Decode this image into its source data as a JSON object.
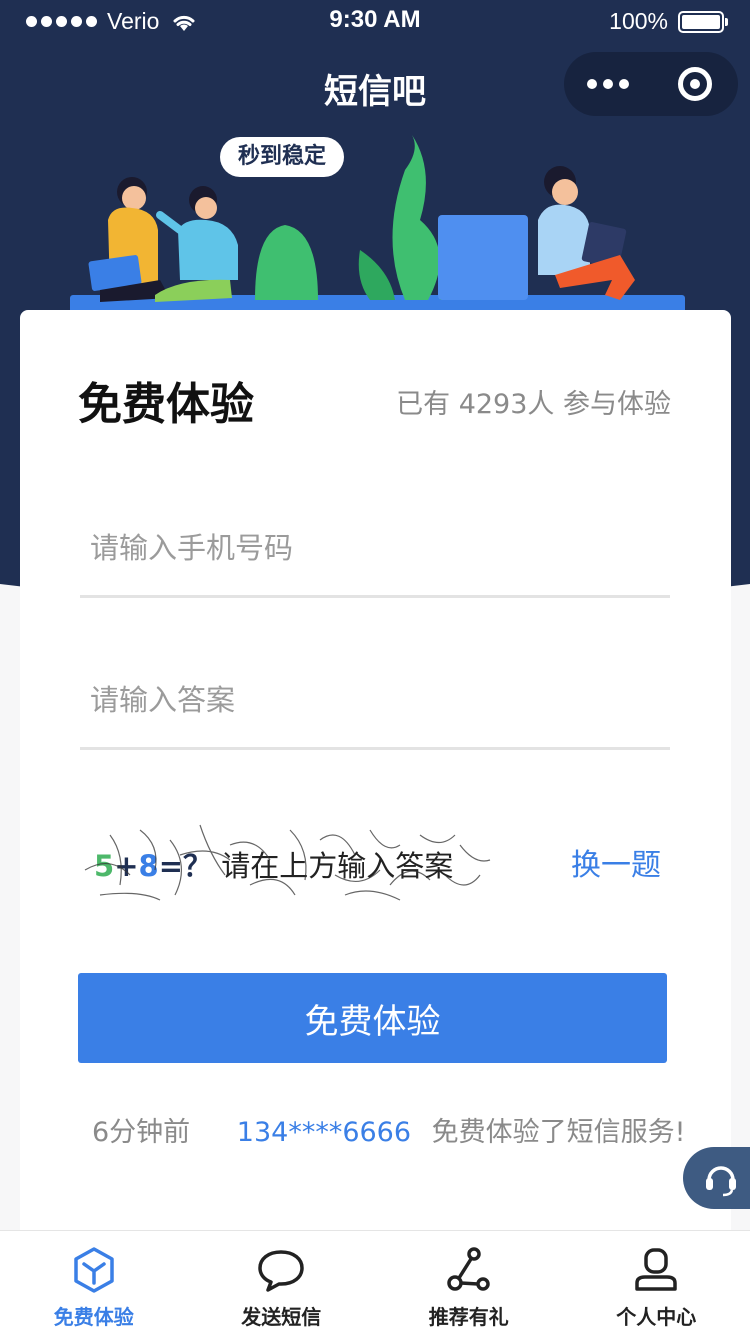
{
  "status_bar": {
    "carrier": "Verio",
    "time": "9:30 AM",
    "battery": "100%"
  },
  "nav": {
    "title": "短信吧"
  },
  "illustration": {
    "bubble_text": "秒到稳定"
  },
  "card": {
    "title": "免费体验",
    "stat_text": "已有 4293人 参与体验",
    "phone_placeholder": "请输入手机号码",
    "answer_placeholder": "请输入答案",
    "captcha": {
      "num1": "5",
      "plus": "+",
      "num2": "8",
      "equals": "=？",
      "hint": "请在上方输入答案"
    },
    "switch_label": "换一题",
    "submit_label": "免费体验",
    "notice": {
      "when": "6分钟前",
      "phone": "134****6666",
      "message": "免费体验了短信服务!"
    }
  },
  "tabs": [
    {
      "label": "免费体验",
      "icon": "cube-icon",
      "active": true
    },
    {
      "label": "发送短信",
      "icon": "chat-bubble-icon",
      "active": false
    },
    {
      "label": "推荐有礼",
      "icon": "share-icon",
      "active": false
    },
    {
      "label": "个人中心",
      "icon": "user-icon",
      "active": false
    }
  ],
  "colors": {
    "header_bg": "#1f2f52",
    "accent": "#3a7fe6",
    "service_bg": "#3e5b82"
  }
}
